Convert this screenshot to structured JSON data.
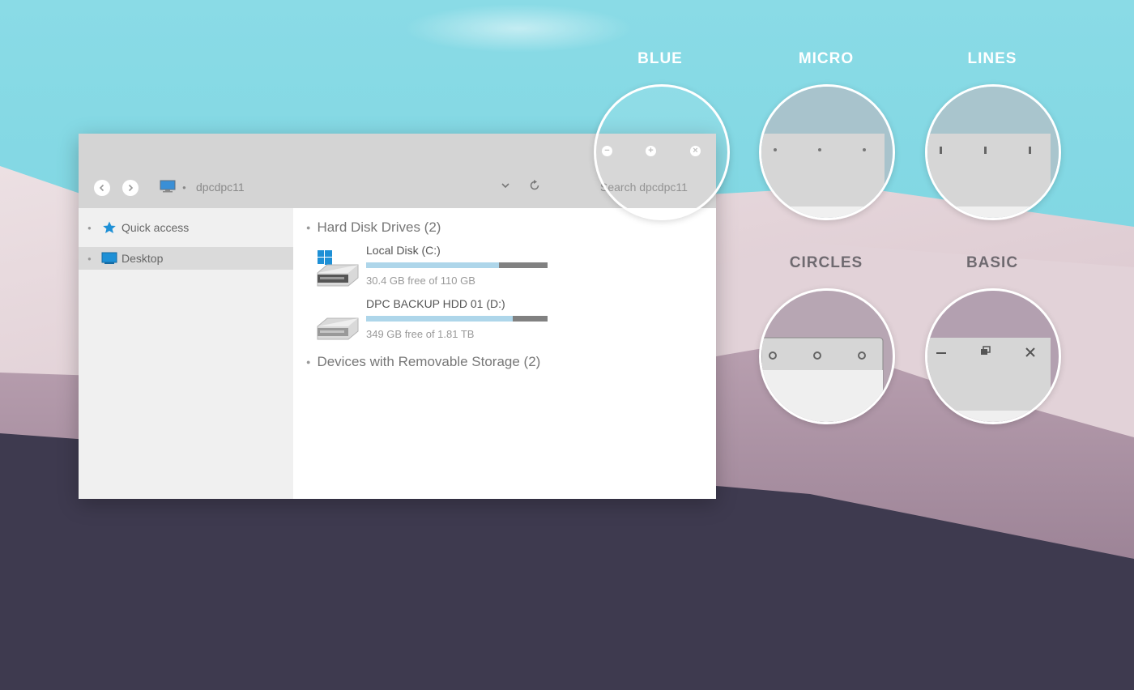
{
  "window": {
    "address": "dpcdpc11",
    "search_placeholder": "Search dpcdpc11",
    "controls": {
      "minimize": "−",
      "maximize": "+",
      "close": "×"
    }
  },
  "sidebar": {
    "items": [
      {
        "label": "Quick access",
        "icon": "star-icon",
        "selected": false
      },
      {
        "label": "Desktop",
        "icon": "desktop-icon",
        "selected": true
      }
    ]
  },
  "content": {
    "groups": [
      {
        "title": "Hard Disk Drives (2)"
      },
      {
        "title": "Devices with Removable Storage (2)"
      }
    ],
    "drives": [
      {
        "name": "Local Disk (C:)",
        "free_text": "30.4 GB free of 110 GB",
        "used_fraction": 0.73,
        "icon": "windows-drive-icon"
      },
      {
        "name": "DPC BACKUP HDD 01 (D:)",
        "free_text": "349 GB free of 1.81 TB",
        "used_fraction": 0.81,
        "icon": "drive-icon"
      }
    ]
  },
  "variants": [
    {
      "label": "BLUE"
    },
    {
      "label": "MICRO"
    },
    {
      "label": "LINES"
    },
    {
      "label": "CIRCLES"
    },
    {
      "label": "BASIC"
    }
  ],
  "colors": {
    "sky": "#7fd6e2",
    "titlebar": "#d4d4d4",
    "sidebar": "#f0f0f0",
    "progress_fill": "#aed6ea",
    "progress_track": "#818181",
    "dark_ground": "#3e3a4f",
    "accent_blue": "#1e90d6"
  }
}
